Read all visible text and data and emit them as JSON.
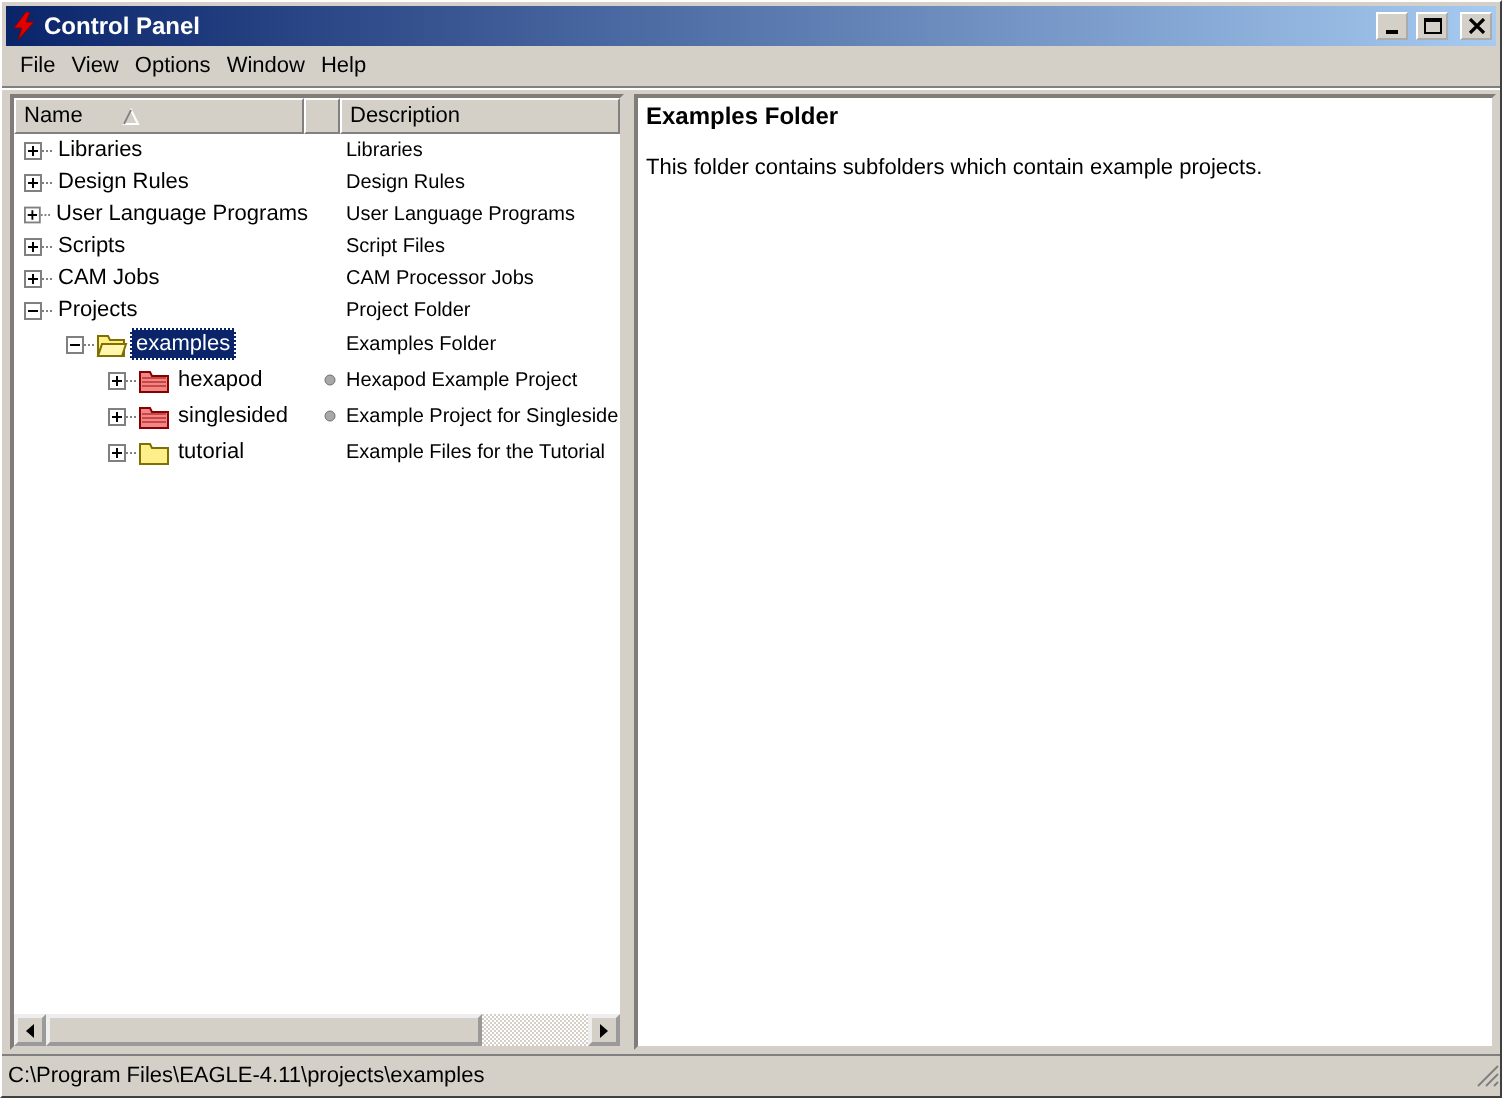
{
  "window": {
    "title": "Control Panel"
  },
  "menu": [
    "File",
    "View",
    "Options",
    "Window",
    "Help"
  ],
  "tree": {
    "columns": [
      "Name",
      "Description"
    ],
    "nodes": [
      {
        "name": "Libraries",
        "description": "Libraries",
        "kind": "item",
        "expanded": false,
        "selected": false
      },
      {
        "name": "Design Rules",
        "description": "Design Rules",
        "kind": "item",
        "expanded": false,
        "selected": false
      },
      {
        "name": "User Language Programs",
        "description": "User Language Programs",
        "kind": "item",
        "expanded": false,
        "selected": false
      },
      {
        "name": "Scripts",
        "description": "Script Files",
        "kind": "item",
        "expanded": false,
        "selected": false
      },
      {
        "name": "CAM Jobs",
        "description": "CAM Processor Jobs",
        "kind": "item",
        "expanded": false,
        "selected": false
      },
      {
        "name": "Projects",
        "description": "Project Folder",
        "kind": "item",
        "expanded": true,
        "selected": false,
        "children": [
          {
            "name": "examples",
            "description": "Examples Folder",
            "kind": "folder",
            "expanded": true,
            "selected": true,
            "children": [
              {
                "name": "hexapod",
                "description": "Hexapod Example Project",
                "kind": "project",
                "expanded": false,
                "selected": false
              },
              {
                "name": "singlesided",
                "description": "Example Project for Singleside",
                "kind": "project",
                "expanded": false,
                "selected": false
              },
              {
                "name": "tutorial",
                "description": "Example Files for the Tutorial",
                "kind": "folder",
                "expanded": false,
                "selected": false
              }
            ]
          }
        ]
      }
    ]
  },
  "detail": {
    "title": "Examples Folder",
    "text": "This folder contains subfolders which contain example projects."
  },
  "status_bar": "C:\\Program Files\\EAGLE-4.11\\projects\\examples"
}
